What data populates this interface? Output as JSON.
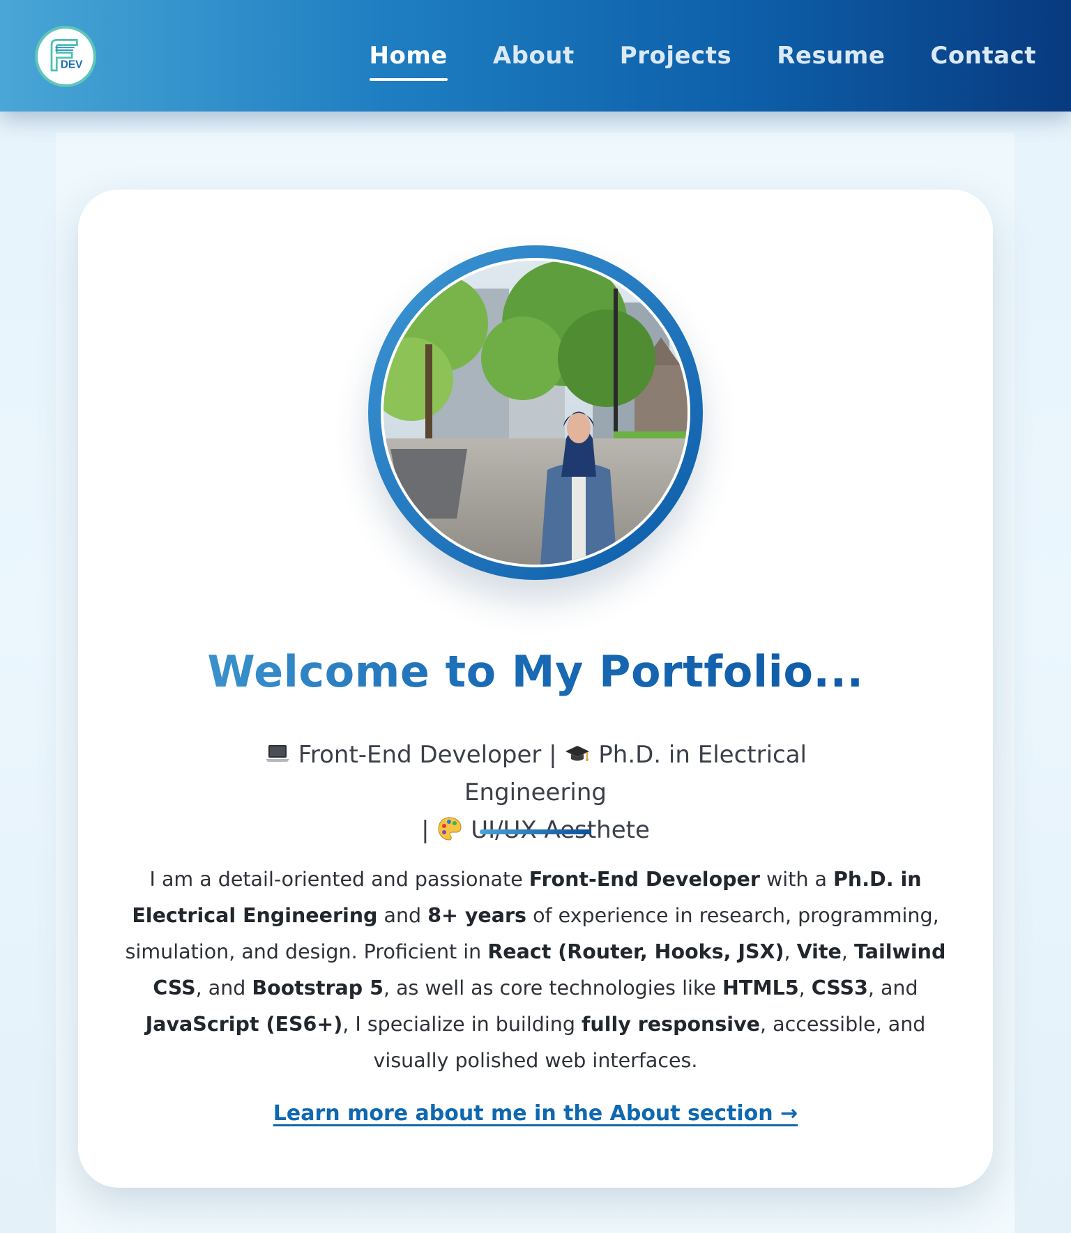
{
  "nav": {
    "logo_text": "DEV",
    "logo_initial": "F",
    "items": [
      {
        "label": "Home",
        "active": true
      },
      {
        "label": "About",
        "active": false
      },
      {
        "label": "Projects",
        "active": false
      },
      {
        "label": "Resume",
        "active": false
      },
      {
        "label": "Contact",
        "active": false
      }
    ]
  },
  "hero": {
    "title": "Welcome to My Portfolio...",
    "roles": [
      {
        "icon": "laptop-icon",
        "text": "Front-End Developer"
      },
      {
        "icon": "graduation-cap-icon",
        "text": "Ph.D. in Electrical Engineering"
      },
      {
        "icon": "palette-icon",
        "text": "UI/UX Aesthete"
      }
    ],
    "separator": "|",
    "bio_segments": [
      {
        "text": "I am a detail-oriented and passionate ",
        "bold": false
      },
      {
        "text": "Front-End Developer",
        "bold": true
      },
      {
        "text": " with a ",
        "bold": false
      },
      {
        "text": "Ph.D. in Electrical Engineering",
        "bold": true
      },
      {
        "text": " and ",
        "bold": false
      },
      {
        "text": "8+ years",
        "bold": true
      },
      {
        "text": " of experience in research, programming, simulation, and design. Proficient in ",
        "bold": false
      },
      {
        "text": "React (Router, Hooks, JSX)",
        "bold": true
      },
      {
        "text": ", ",
        "bold": false
      },
      {
        "text": "Vite",
        "bold": true
      },
      {
        "text": ", ",
        "bold": false
      },
      {
        "text": "Tailwind CSS",
        "bold": true
      },
      {
        "text": ", and ",
        "bold": false
      },
      {
        "text": "Bootstrap 5",
        "bold": true
      },
      {
        "text": ", as well as core technologies like ",
        "bold": false
      },
      {
        "text": "HTML5",
        "bold": true
      },
      {
        "text": ", ",
        "bold": false
      },
      {
        "text": "CSS3",
        "bold": true
      },
      {
        "text": ", and ",
        "bold": false
      },
      {
        "text": "JavaScript (ES6+)",
        "bold": true
      },
      {
        "text": ", I specialize in building ",
        "bold": false
      },
      {
        "text": "fully responsive",
        "bold": true
      },
      {
        "text": ", accessible, and visually polished web interfaces.",
        "bold": false
      }
    ],
    "about_link": "Learn more about me in the About section →"
  },
  "colors": {
    "nav_gradient_start": "#4aa6d6",
    "nav_gradient_end": "#083a7f",
    "accent": "#0f68b0",
    "title_gradient_start": "#4aa3d8",
    "title_gradient_end": "#0b55a3",
    "logo_ring": "#5fc6b8"
  }
}
